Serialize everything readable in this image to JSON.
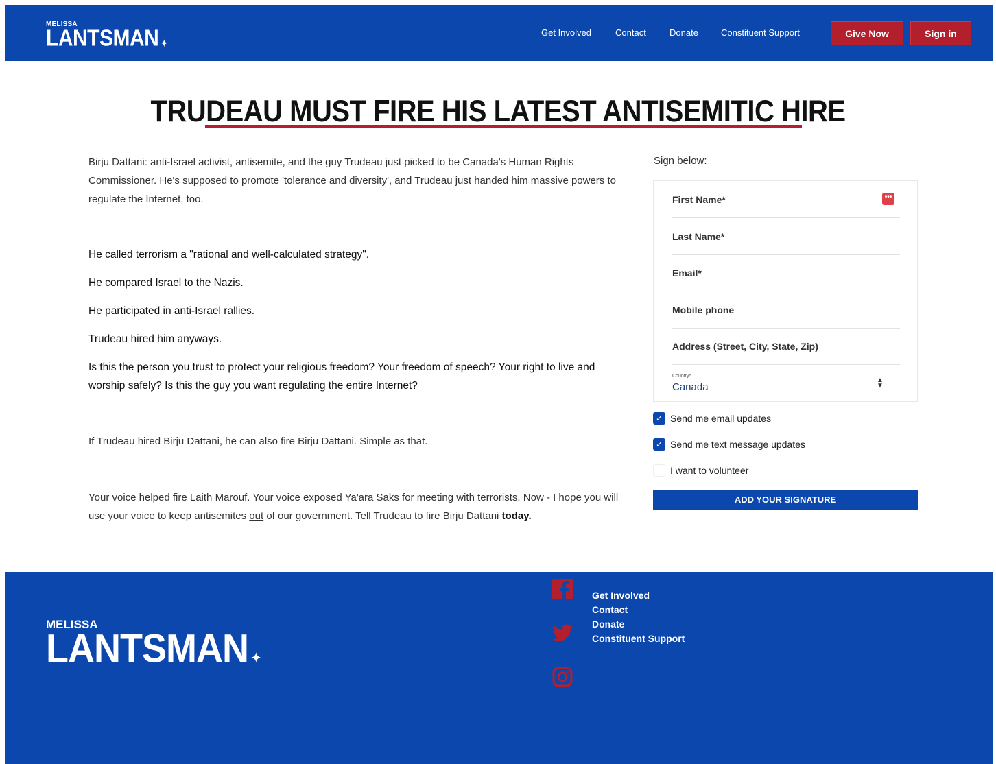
{
  "header": {
    "logo_first": "MELISSA",
    "logo_last": "LANTSMAN",
    "nav": [
      "Get Involved",
      "Contact",
      "Donate",
      "Constituent Support"
    ],
    "give_now": "Give Now",
    "sign_in": "Sign in"
  },
  "page_title": "TRUDEAU MUST FIRE HIS LATEST ANTISEMITIC HIRE",
  "body": {
    "intro": "Birju Dattani: anti-Israel activist, antisemite, and the guy Trudeau just picked to be Canada's Human Rights Commissioner. He's supposed to promote 'tolerance and diversity', and Trudeau just handed him massive powers to regulate the Internet, too.",
    "point1": "He called terrorism a \"rational and well-calculated strategy\".",
    "point2": "He compared Israel to the Nazis.",
    "point3": "He participated in anti-Israel rallies.",
    "point4": "Trudeau hired him anyways.",
    "question": "Is this the person you trust to protect your religious freedom? Your freedom of speech? Your right to live and worship safely? Is this the guy you want regulating the entire Internet?",
    "fire_line": "If Trudeau hired Birju Dattani, he can also fire Birju Dattani. Simple as that.",
    "closing_a": "Your voice helped fire Laith Marouf. Your voice exposed Ya'ara Saks for meeting with terrorists. Now - I hope you will use your voice to keep antisemites ",
    "closing_out": "out",
    "closing_b": " of our government. Tell Trudeau to fire Birju Dattani ",
    "closing_today": "today."
  },
  "form": {
    "sign_below": "Sign below:",
    "first_name": "First Name*",
    "last_name": "Last Name*",
    "email": "Email*",
    "mobile": "Mobile phone",
    "address": "Address (Street, City, State, Zip)",
    "country_label": "Country*",
    "country_value": "Canada",
    "email_updates": "Send me email updates",
    "text_updates": "Send me text message updates",
    "volunteer": "I want to volunteer",
    "email_updates_checked": true,
    "text_updates_checked": true,
    "volunteer_checked": false,
    "submit": "ADD YOUR SIGNATURE"
  },
  "footer": {
    "logo_first": "MELISSA",
    "logo_last": "LANTSMAN",
    "links": [
      "Get Involved",
      "Contact",
      "Donate",
      "Constituent Support"
    ],
    "social_icons": [
      "facebook-icon",
      "twitter-icon",
      "instagram-icon"
    ]
  },
  "colors": {
    "brand_blue": "#0b47ad",
    "brand_red": "#b41f2e"
  }
}
